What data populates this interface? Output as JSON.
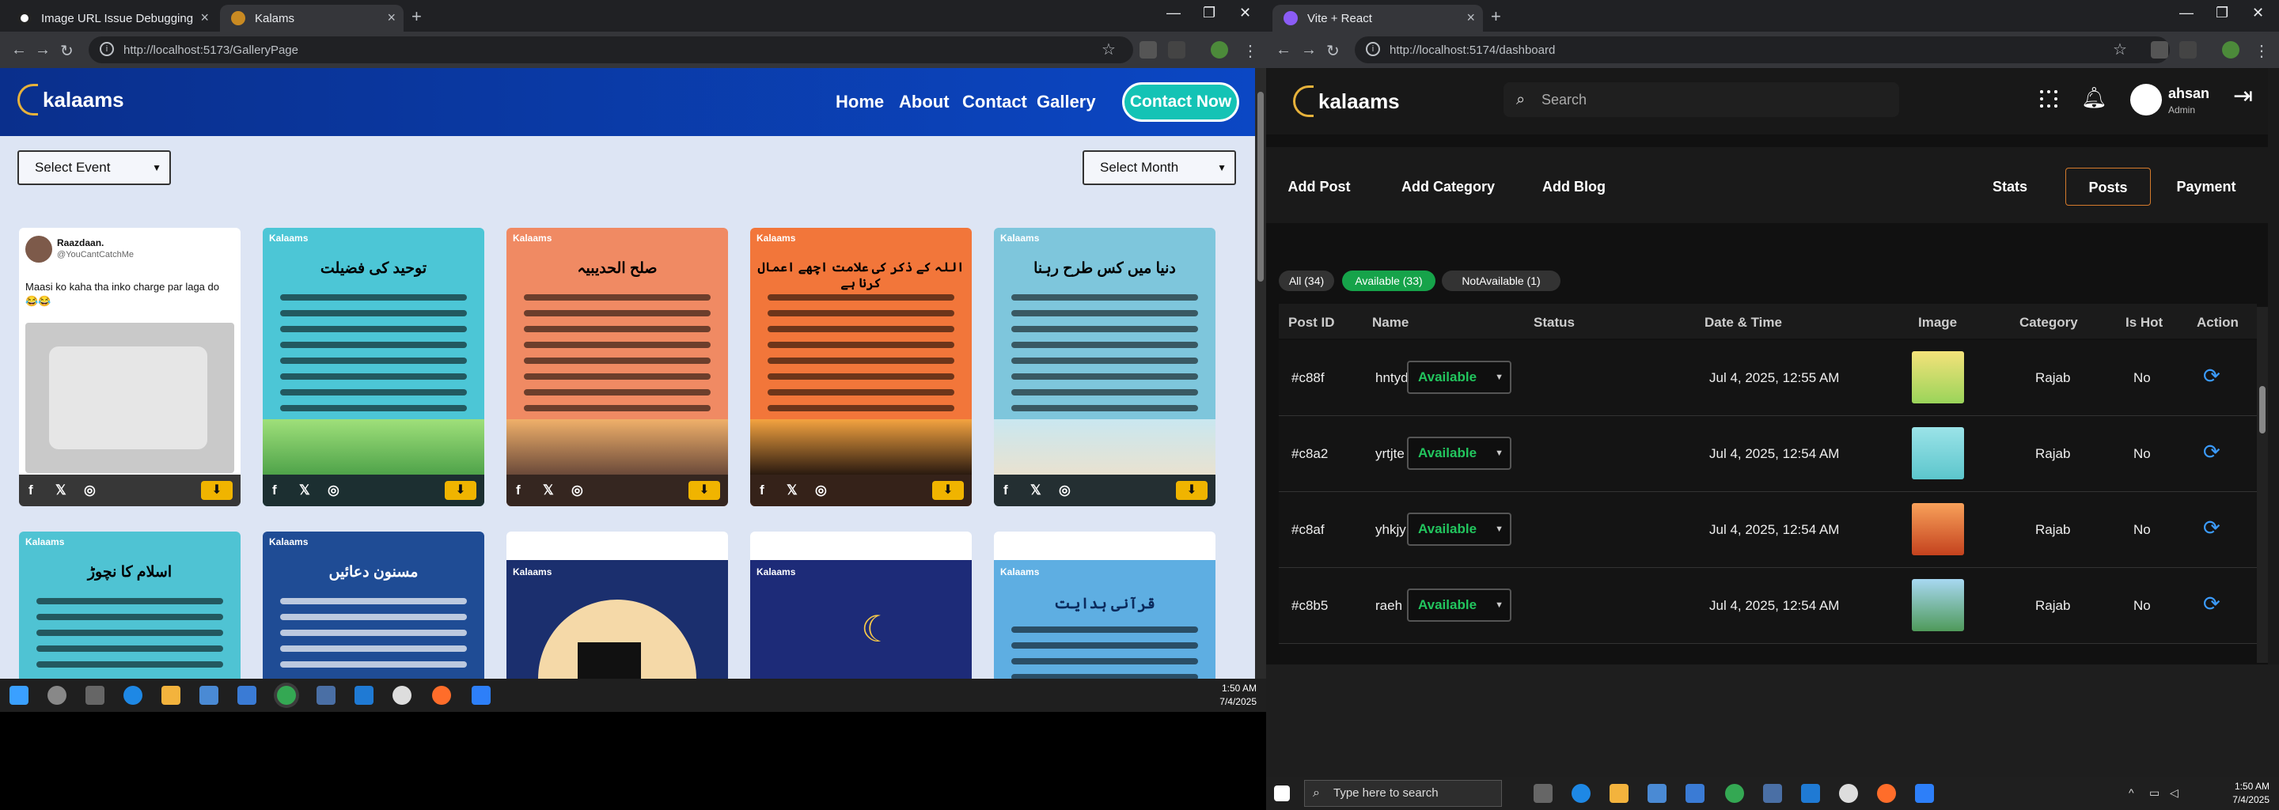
{
  "left_browser": {
    "tabs": [
      {
        "title": "Image URL Issue Debugging"
      },
      {
        "title": "Kalams"
      }
    ],
    "url": "http://localhost:5173/GalleryPage",
    "site": {
      "logo_text": "kalaams",
      "nav": [
        "Home",
        "About",
        "Contact",
        "Gallery"
      ],
      "cta": "Contact Now",
      "select_event": "Select Event",
      "select_month": "Select Month",
      "tweet": {
        "name": "Raazdaan.",
        "handle": "@YouCantCatchMe",
        "text": "Maasi ko kaha tha inko charge par laga do 😂😂"
      },
      "cards_row1": [
        {
          "title": "توحید کی فضیلت",
          "bg": "#4cc6d6"
        },
        {
          "title": "صلح الحدیبیہ",
          "bg": "#f08a63"
        },
        {
          "title": "اللہ کے ذکر کی علامت اچھے اعمال کرنا ہے",
          "bg": "#f2763a"
        },
        {
          "title": "دنیا میں کس طرح رہنا",
          "bg": "#7ec6dc"
        }
      ],
      "cards_row2": [
        {
          "title": "اسلام کا نچوڑ",
          "bg": "#4fc3d3"
        },
        {
          "title": "مسنون دعائیں",
          "bg": "#1f4c95"
        },
        {
          "title": "",
          "bg": "#1b2f6e"
        },
        {
          "title": "",
          "bg": "#1d2b78"
        },
        {
          "title": "قرآنی ہدایت",
          "bg": "#5eaee2"
        }
      ],
      "card_brand": "Kalaams",
      "social": [
        "f",
        "𝕏",
        "◎"
      ]
    },
    "clock": {
      "time": "1:50 AM",
      "date": "7/4/2025"
    }
  },
  "right_browser": {
    "tabs": [
      {
        "title": "Vite + React"
      }
    ],
    "url": "http://localhost:5174/dashboard",
    "app": {
      "logo_text": "kalaams",
      "search_placeholder": "Search",
      "user": {
        "name": "ahsan",
        "role": "Admin"
      },
      "actions": [
        "Add Post",
        "Add Category",
        "Add Blog"
      ],
      "views": [
        "Stats",
        "Posts",
        "Payment"
      ],
      "active_view": "Posts",
      "filters": [
        "All (34)",
        "Available (33)",
        "NotAvailable (1)"
      ],
      "columns": [
        "Post ID",
        "Name",
        "Status",
        "Date & Time",
        "Image",
        "Category",
        "Is Hot",
        "Action"
      ],
      "rows": [
        {
          "id": "#c88f",
          "name": "hntydnh",
          "status": "Available",
          "date": "Jul 4, 2025, 12:55 AM",
          "category": "Rajab",
          "hot": "No",
          "thumb": "#9ad45a"
        },
        {
          "id": "#c8a2",
          "name": "yrtjte",
          "status": "Available",
          "date": "Jul 4, 2025, 12:54 AM",
          "category": "Rajab",
          "hot": "No",
          "thumb": "#5cc6cc"
        },
        {
          "id": "#c8af",
          "name": "yhkjy",
          "status": "Available",
          "date": "Jul 4, 2025, 12:54 AM",
          "category": "Rajab",
          "hot": "No",
          "thumb": "#f06a3a"
        },
        {
          "id": "#c8b5",
          "name": "raeh",
          "status": "Available",
          "date": "Jul 4, 2025, 12:54 AM",
          "category": "Rajab",
          "hot": "No",
          "thumb": "#6cb6e0"
        }
      ]
    },
    "taskbar_search": "Type here to search",
    "clock": {
      "time": "1:50 AM",
      "date": "7/4/2025"
    }
  }
}
